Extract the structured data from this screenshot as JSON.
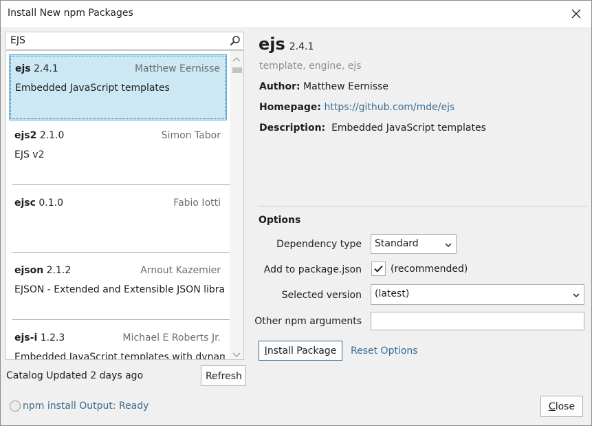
{
  "window": {
    "title": "Install New npm Packages"
  },
  "search": {
    "value": "EJS",
    "placeholder": ""
  },
  "packages": [
    {
      "name": "ejs",
      "version": "2.4.1",
      "author": "Matthew Eernisse",
      "description": "Embedded JavaScript templates",
      "selected": true
    },
    {
      "name": "ejs2",
      "version": "2.1.0",
      "author": "Simon Tabor",
      "description": "EJS v2",
      "selected": false
    },
    {
      "name": "ejsc",
      "version": "0.1.0",
      "author": "Fabio Iotti",
      "description": "",
      "selected": false
    },
    {
      "name": "ejson",
      "version": "2.1.2",
      "author": "Arnout Kazemier",
      "description": "EJSON - Extended and Extensible JSON libra...",
      "selected": false
    },
    {
      "name": "ejs-i",
      "version": "1.2.3",
      "author": "Michael E Roberts Jr.",
      "description": "Embedded JavaScript templates with dynam...",
      "selected": false
    }
  ],
  "catalog": {
    "status": "Catalog Updated 2 days ago",
    "refresh_label": "Refresh"
  },
  "details": {
    "name": "ejs",
    "version": "2.4.1",
    "keywords": "template, engine, ejs",
    "author_label": "Author:",
    "author": "Matthew Eernisse",
    "homepage_label": "Homepage:",
    "homepage": "https://github.com/mde/ejs",
    "description_label": "Description:",
    "description": "Embedded JavaScript templates"
  },
  "options": {
    "heading": "Options",
    "dependency_type_label": "Dependency type",
    "dependency_type_value": "Standard",
    "add_to_package_label": "Add to package.json",
    "add_to_package_checked": true,
    "add_to_package_note": "(recommended)",
    "selected_version_label": "Selected version",
    "selected_version_value": "(latest)",
    "other_args_label": "Other npm arguments",
    "other_args_value": ""
  },
  "actions": {
    "install_prefix": "I",
    "install_rest": "nstall Package",
    "reset_label": "Reset Options",
    "close_prefix": "C",
    "close_rest": "lose"
  },
  "status": {
    "text": "npm install Output: Ready"
  },
  "colors": {
    "selection_bg": "#cce8f4",
    "selection_border": "#57a8d8",
    "link": "#3a6d95"
  }
}
